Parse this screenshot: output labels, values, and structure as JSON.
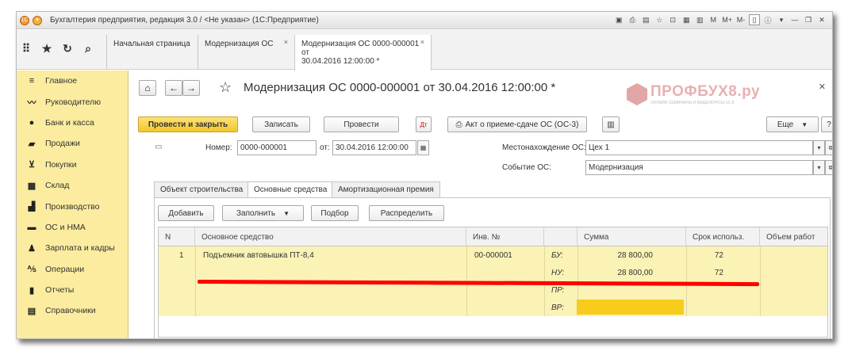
{
  "window": {
    "title": "Бухгалтерия предприятия, редакция 3.0 / <Не указан>  (1С:Предприятие)",
    "controls": [
      "M",
      "M+",
      "M-"
    ]
  },
  "tabs": [
    {
      "label": "Начальная страница"
    },
    {
      "label": "Модернизация ОС",
      "close": "×"
    },
    {
      "label_line1": "Модернизация ОС 0000-000001 от",
      "label_line2": "30.04.2016 12:00:00 *",
      "close": "×"
    }
  ],
  "sidebar": {
    "items": [
      {
        "label": "Главное",
        "icon": "menu-icon"
      },
      {
        "label": "Руководителю",
        "icon": "trend-icon"
      },
      {
        "label": "Банк и касса",
        "icon": "coin-icon"
      },
      {
        "label": "Продажи",
        "icon": "bag-icon"
      },
      {
        "label": "Покупки",
        "icon": "cart-icon"
      },
      {
        "label": "Склад",
        "icon": "warehouse-icon"
      },
      {
        "label": "Производство",
        "icon": "factory-icon"
      },
      {
        "label": "ОС и НМА",
        "icon": "truck-icon"
      },
      {
        "label": "Зарплата и кадры",
        "icon": "person-icon"
      },
      {
        "label": "Операции",
        "icon": "operations-icon"
      },
      {
        "label": "Отчеты",
        "icon": "bar-chart-icon"
      },
      {
        "label": "Справочники",
        "icon": "book-icon"
      }
    ]
  },
  "document": {
    "title": "Модернизация ОС 0000-000001 от 30.04.2016 12:00:00 *",
    "logo": {
      "name": "ПРОФБУХ8.ру",
      "subtitle": "ОНЛАЙН СЕМИНАРЫ И ВИДЕОКУРСЫ 1С:8"
    },
    "toolbar": {
      "post_close": "Провести и закрыть",
      "save": "Записать",
      "post": "Провести",
      "print_act": "Акт о приеме-сдаче ОС (ОС-3)",
      "more": "Еще",
      "help": "?"
    },
    "fields": {
      "number_label": "Номер:",
      "number_value": "0000-000001",
      "date_label": "от:",
      "date_value": "30.04.2016 12:00:00",
      "location_label": "Местонахождение ОС:",
      "location_value": "Цех 1",
      "event_label": "Событие ОС:",
      "event_value": "Модернизация"
    },
    "inner_tabs": [
      "Объект строительства",
      "Основные средства",
      "Амортизационная премия"
    ],
    "table_toolbar": {
      "add": "Добавить",
      "fill": "Заполнить",
      "select": "Подбор",
      "distribute": "Распределить"
    },
    "table": {
      "columns": [
        "N",
        "Основное средство",
        "Инв. №",
        "",
        "Сумма",
        "Срок использ.",
        "Объем работ"
      ],
      "rows": [
        {
          "n": "1",
          "asset": "Подъемник автовышка ПТ-8,4",
          "inv": "00-000001",
          "lines": [
            {
              "type": "БУ:",
              "sum": "28 800,00",
              "term": "72"
            },
            {
              "type": "НУ:",
              "sum": "28 800,00",
              "term": "72"
            },
            {
              "type": "ПР:",
              "sum": "",
              "term": ""
            },
            {
              "type": "ВР:",
              "sum": "",
              "term": ""
            }
          ]
        }
      ]
    }
  }
}
